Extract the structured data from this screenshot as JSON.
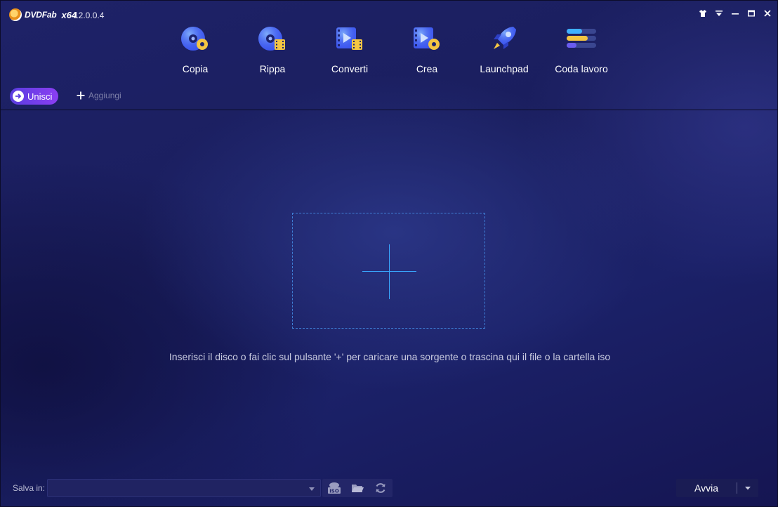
{
  "app": {
    "logo_text": "DVDFab",
    "arch": "x64",
    "version": "12.0.0.4"
  },
  "window_controls": [
    {
      "icon": "skin-icon"
    },
    {
      "icon": "menu-dropdown-icon"
    },
    {
      "icon": "minimize-icon"
    },
    {
      "icon": "maximize-icon"
    },
    {
      "icon": "close-icon"
    }
  ],
  "nav": {
    "items": [
      {
        "label": "Copia",
        "icon": "disc-copy-icon"
      },
      {
        "label": "Rippa",
        "icon": "disc-ripper-icon"
      },
      {
        "label": "Converti",
        "icon": "video-converter-icon"
      },
      {
        "label": "Crea",
        "icon": "disc-creator-icon"
      },
      {
        "label": "Launchpad",
        "icon": "rocket-icon"
      },
      {
        "label": "Coda lavoro",
        "icon": "task-queue-icon"
      }
    ]
  },
  "subbar": {
    "merge_label": "Unisci",
    "add_label": "Aggiungi"
  },
  "dropzone": {
    "hint": "Inserisci il disco o fai clic sul pulsante '+' per caricare una sorgente o trascina qui il file o la cartella iso"
  },
  "bottom": {
    "save_label": "Salva in:",
    "save_path": "",
    "start_label": "Avvia"
  },
  "colors": {
    "accent": "#39a8ff",
    "merge_button": "#7a3cf0",
    "background": "#1c2064"
  }
}
